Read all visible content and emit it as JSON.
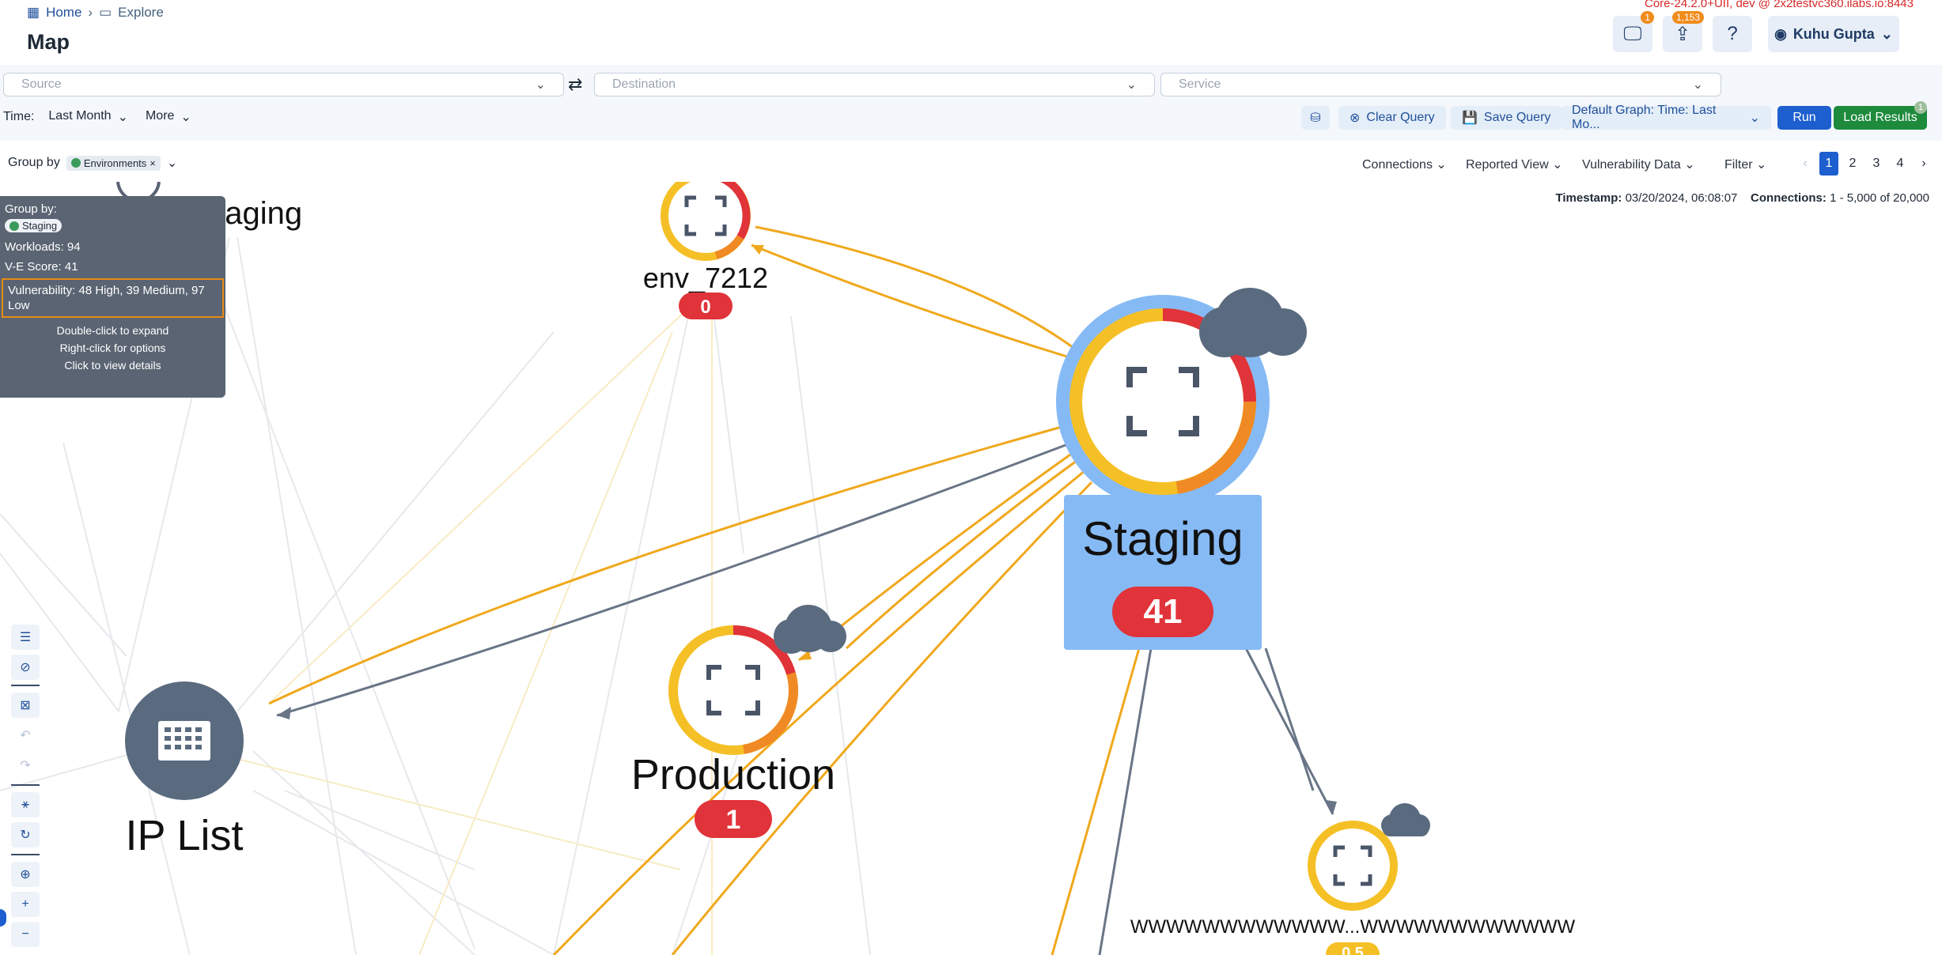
{
  "header": {
    "breadcrumb": [
      "Home",
      "Explore"
    ],
    "title": "Map",
    "version": "Core-24.2.0+UII, dev @ 2x2testvc360.ilabs.io:8443",
    "alerts_badge": "1",
    "upload_badge": "1,153",
    "help_label": "?",
    "user_name": "Kuhu Gupta"
  },
  "query": {
    "source_placeholder": "Source",
    "destination_placeholder": "Destination",
    "service_placeholder": "Service",
    "time_label": "Time:",
    "time_value": "Last Month",
    "more_label": "More",
    "clear_query": "Clear Query",
    "save_query": "Save Query",
    "default_graph": "Default Graph: Time: Last Mo...",
    "run": "Run",
    "load_results": "Load Results",
    "load_badge": "1"
  },
  "controls": {
    "group_by_label": "Group by",
    "group_by_chip": "Environments",
    "connections": "Connections",
    "reported_view": "Reported View",
    "vulnerability_data": "Vulnerability Data",
    "filter": "Filter",
    "pages": [
      "1",
      "2",
      "3",
      "4"
    ],
    "active_page": "1",
    "timestamp_label": "Timestamp:",
    "timestamp_value": "03/20/2024, 06:08:07",
    "connections_label": "Connections:",
    "connections_value": "1 - 5,000 of 20,000"
  },
  "tooltip": {
    "group_by_label": "Group by:",
    "group_chip": "Staging",
    "workloads": "Workloads:  94",
    "ve_score": "V-E Score:  41",
    "vulnerability": "Vulnerability:  48 High, 39 Medium, 97 Low",
    "hint_expand": "Double-click to expand",
    "hint_options": "Right-click for options",
    "hint_details": "Click to view details"
  },
  "nodes": {
    "test_staging": "testStaging",
    "env_7212": {
      "label": "env_7212",
      "score": "0"
    },
    "staging": {
      "label": "Staging",
      "score": "41"
    },
    "production": {
      "label": "Production",
      "score": "1"
    },
    "ip_list": {
      "label": "IP List"
    },
    "wwww": {
      "label": "WWWWWWWWWWWW...WWWWWWWWWWWW",
      "score": "0.5"
    }
  },
  "colors": {
    "accent": "#1d5fcf",
    "high": "#e0333a",
    "medium": "#f08a24",
    "low": "#f5c026",
    "cloud": "#5a6b80"
  }
}
